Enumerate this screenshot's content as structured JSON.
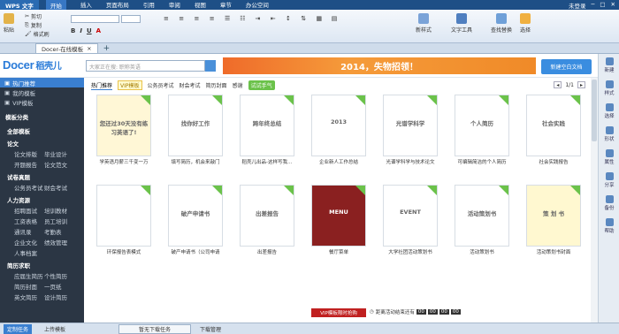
{
  "title_bar": {
    "app": "WPS 文字",
    "menu": [
      "开始",
      "插入",
      "页面布局",
      "引用",
      "审阅",
      "视图",
      "章节",
      "办公空间"
    ],
    "active_menu": "开始",
    "right": [
      "未登录"
    ]
  },
  "ribbon": {
    "buttons": [
      "剪切",
      "粘贴",
      "复制",
      "格式刷",
      "新样式",
      "文字工具",
      "查找替换",
      "选择"
    ]
  },
  "doc_tab": {
    "label": "Docer-在线模板"
  },
  "header": {
    "logo": "Docer",
    "logo_cn": "稻壳儿",
    "search_placeholder": "大家正在搜: 职称英语",
    "banner": "2014，失物招领！",
    "button": "新建空白文档"
  },
  "sidebar": {
    "nav": [
      "热门推荐",
      "我的模板",
      "VIP模板"
    ],
    "section_title": "模板分类",
    "categories": [
      {
        "name": "全部模板",
        "subs": []
      },
      {
        "name": "论文",
        "subs": [
          [
            "论文排版",
            "毕业设计"
          ],
          [
            "开题报告",
            "论文范文"
          ]
        ]
      },
      {
        "name": "试卷真题",
        "subs": [
          [
            "公务员考试",
            "财会考试"
          ]
        ]
      },
      {
        "name": "人力资源",
        "subs": [
          [
            "招聘面试",
            "培训教材"
          ],
          [
            "工资表格",
            "员工培训"
          ],
          [
            "通讯录",
            "考勤表"
          ],
          [
            "企业文化",
            "绩效管理"
          ],
          [
            "人事档案",
            ""
          ]
        ]
      },
      {
        "name": "简历求职",
        "subs": [
          [
            "应届生简历",
            "个性简历"
          ],
          [
            "简历封面",
            "一页纸"
          ],
          [
            "英文简历",
            "设计简历"
          ]
        ]
      }
    ]
  },
  "filters": [
    "热门推荐",
    "VIP模板",
    "公务员考试",
    "财会考试",
    "简历封面",
    "感谢",
    "试试手气"
  ],
  "pager": {
    "current": "1",
    "total": "1/1"
  },
  "cards": [
    {
      "caption": "学英语月薪三千变一万",
      "thumb_text": "您还过30天没有练习英语了!",
      "color": "#fff7d6"
    },
    {
      "caption": "填写简历，机会来敲门",
      "thumb_text": "找你好工作",
      "color": "#fff"
    },
    {
      "caption": "稻壳儿出品-这样写我…",
      "thumb_text": "跨年终总结",
      "color": "#fff"
    },
    {
      "caption": "企业新人工作总结",
      "thumb_text": "2013",
      "color": "#fff"
    },
    {
      "caption": "光谱学科学与技术论文",
      "thumb_text": "光谱学科学",
      "color": "#fff"
    },
    {
      "caption": "可编辑简洁的个人简历",
      "thumb_text": "个人简历",
      "color": "#fff"
    },
    {
      "caption": "社会实践报告",
      "thumb_text": "社会实践",
      "color": "#fff"
    },
    {
      "caption": "环保报告表模式",
      "thumb_text": "",
      "color": "#fff"
    },
    {
      "caption": "破产申请书（公司申请",
      "thumb_text": "破产申请书",
      "color": "#fff"
    },
    {
      "caption": "出差报告",
      "thumb_text": "出差报告",
      "color": "#fff"
    },
    {
      "caption": "餐厅菜单",
      "thumb_text": "MENU",
      "color": "#8a2020"
    },
    {
      "caption": "大学社团活动策划书",
      "thumb_text": "EVENT",
      "color": "#fff"
    },
    {
      "caption": "活动策划书",
      "thumb_text": "活动策划书",
      "color": "#fff"
    },
    {
      "caption": "活动策划书封面",
      "thumb_text": "策 划 书",
      "color": "#fff8d0"
    }
  ],
  "ad": "VIP模板限时抢购",
  "countdown": {
    "label": "距离活动结束还有",
    "d": "00",
    "h": "00",
    "m": "00",
    "s": "00"
  },
  "rightpane": [
    "新建",
    "样式",
    "选择",
    "形状",
    "属性",
    "分享",
    "备份",
    "帮助"
  ],
  "bottom": {
    "items": [
      "定制任务",
      "上传模板",
      "暂无下载任务",
      "下载管理"
    ]
  }
}
